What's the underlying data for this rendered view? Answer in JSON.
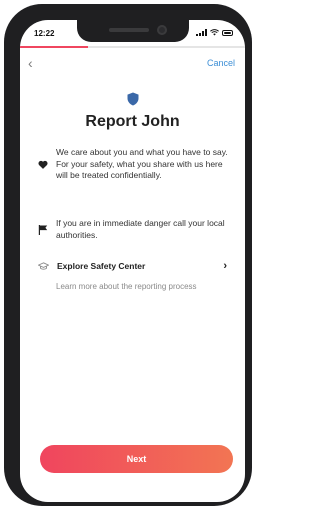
{
  "status_bar": {
    "time": "12:22"
  },
  "progress": {
    "fraction": 0.3
  },
  "nav": {
    "back_icon": "chevron-left-icon",
    "back_glyph": "‹",
    "cancel_label": "Cancel"
  },
  "header": {
    "icon": "shield-icon",
    "title": "Report John"
  },
  "info_rows": [
    {
      "icon": "heart-icon",
      "text": "We care about you and what you have to say. For your safety, what you share with us here will be treated confidentially."
    },
    {
      "icon": "flag-icon",
      "text": "If you are in immediate danger call your local authorities."
    }
  ],
  "safety_center": {
    "icon": "graduation-cap-icon",
    "label": "Explore Safety Center",
    "chevron": "›",
    "subtitle": "Learn more about the reporting process"
  },
  "footer": {
    "next_label": "Next"
  },
  "colors": {
    "accent_start": "#f0455e",
    "accent_end": "#f27553",
    "link": "#3d8fd6",
    "shield": "#3a68a8"
  }
}
